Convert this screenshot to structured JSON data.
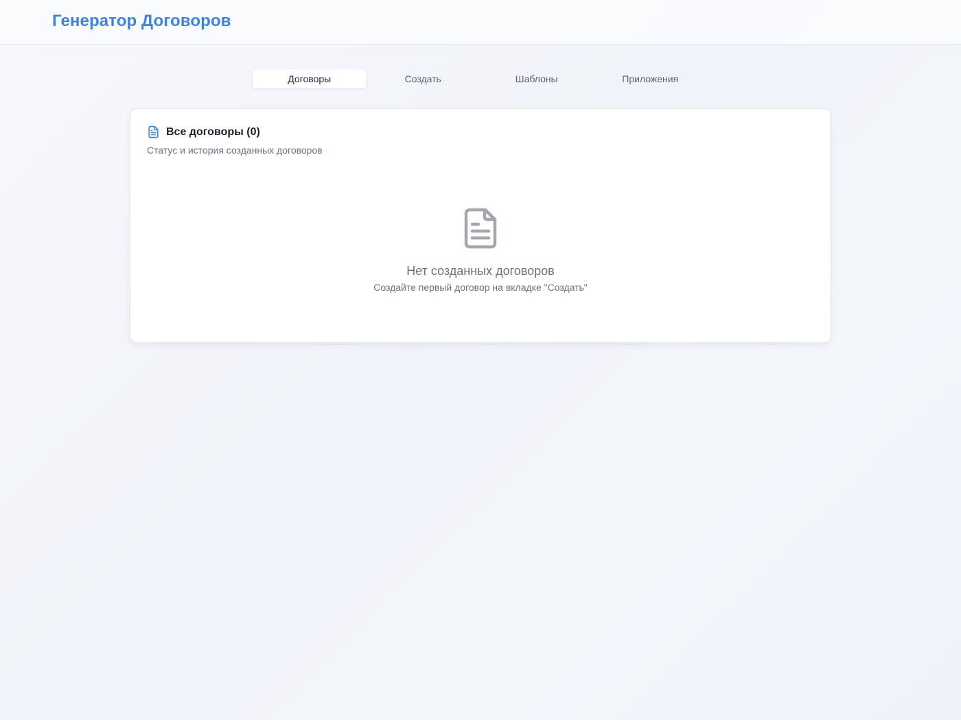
{
  "header": {
    "app_title": "Генератор Договоров"
  },
  "tabs": [
    {
      "label": "Договоры",
      "active": true
    },
    {
      "label": "Создать",
      "active": false
    },
    {
      "label": "Шаблоны",
      "active": false
    },
    {
      "label": "Приложения",
      "active": false
    }
  ],
  "card": {
    "icon": "file-text-icon",
    "title": "Все договоры (0)",
    "subtitle": "Статус и история созданных договоров"
  },
  "empty_state": {
    "icon": "file-text-icon",
    "title": "Нет созданных договоров",
    "subtitle": "Создайте первый договор на вкладке \"Создать\""
  },
  "colors": {
    "accent": "#3f84dc",
    "muted_text": "#6b7280",
    "empty_icon": "#a3a6ab"
  }
}
